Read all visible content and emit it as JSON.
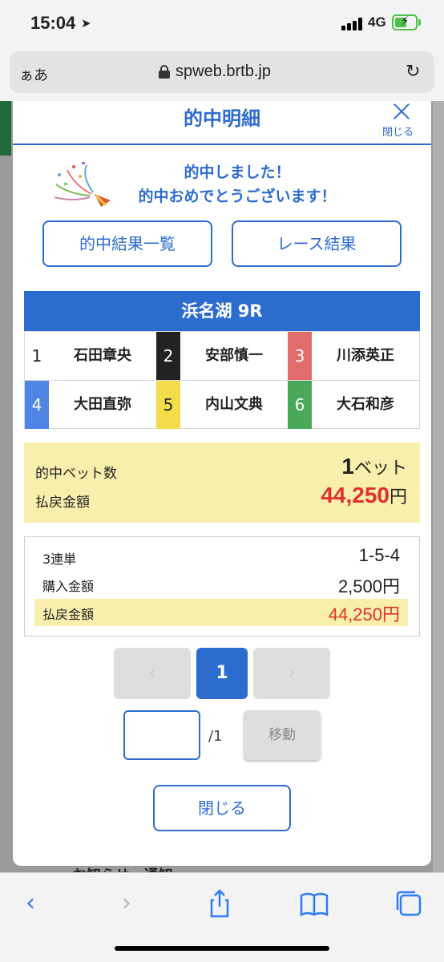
{
  "status_bar": {
    "time": "15:04",
    "network": "4G"
  },
  "browser": {
    "aa_label": "ぁあ",
    "url": "spweb.brtb.jp"
  },
  "modal": {
    "title": "的中明細",
    "close_label": "閉じる",
    "congrats_line1": "的中しました！",
    "congrats_line2": "的中おめでとうございます！",
    "btn_results_list": "的中結果一覧",
    "btn_race_results": "レース結果",
    "race_name": "浜名湖 9R",
    "racers": [
      {
        "num": "1",
        "name": "石田章央",
        "color": "#ffffff",
        "text_color": "#222222"
      },
      {
        "num": "2",
        "name": "安部慎一",
        "color": "#222222",
        "text_color": "#ffffff"
      },
      {
        "num": "3",
        "name": "川添英正",
        "color": "#e26b6b",
        "text_color": "#ffffff"
      },
      {
        "num": "4",
        "name": "大田直弥",
        "color": "#4f86e6",
        "text_color": "#ffffff"
      },
      {
        "num": "5",
        "name": "内山文典",
        "color": "#f2dc4a",
        "text_color": "#222222"
      },
      {
        "num": "6",
        "name": "大石和彦",
        "color": "#4aa85a",
        "text_color": "#ffffff"
      }
    ],
    "summary": {
      "bets_label": "的中ベット数",
      "bets_count": "1",
      "bets_unit": "ベット",
      "payout_label": "払戻金額",
      "payout_value": "44,250",
      "payout_unit": "円"
    },
    "detail": {
      "bet_type": "3連単",
      "combination": "1-5-4",
      "purchase_label": "購入金額",
      "purchase_value": "2,500円",
      "payout_label": "払戻金額",
      "payout_value": "44,250円"
    },
    "pager": {
      "prev": "‹",
      "current": "1",
      "next": "›",
      "total": "/1",
      "move_label": "移動"
    },
    "close_button": "閉じる"
  },
  "page_behind": {
    "bottom_text": "お知らせ・通知"
  },
  "colors": {
    "accent": "#2d6ccf",
    "highlight": "#f9efad",
    "payout_red": "#e0302a"
  }
}
